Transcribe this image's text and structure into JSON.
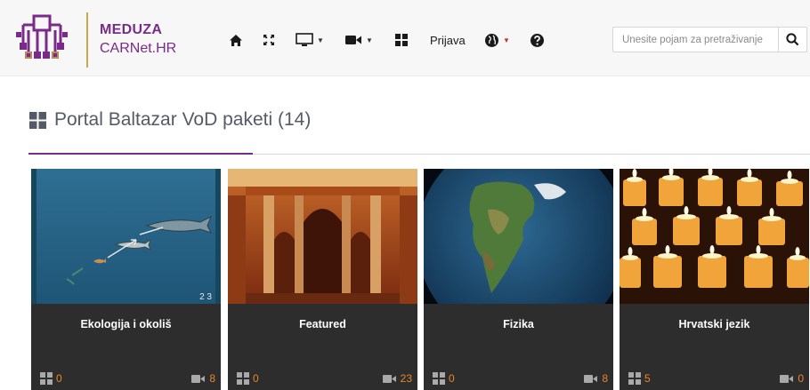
{
  "brand": {
    "title": "MEDUZA",
    "subtitle": "CARNet.HR"
  },
  "nav": {
    "icons": [
      "home-icon",
      "fullscreen-icon",
      "monitor-icon",
      "video-camera-icon",
      "grid-icon",
      "globe-icon",
      "help-icon"
    ],
    "login_label": "Prijava"
  },
  "search": {
    "placeholder": "Unesite pojam za pretraživanje"
  },
  "heading": {
    "title": "Portal Baltazar VoD paketi (14)"
  },
  "cards": [
    {
      "title": "Ekologija i okoliš",
      "packages": "0",
      "videos": "8",
      "frame_number": "2 3"
    },
    {
      "title": "Featured",
      "packages": "0",
      "videos": "23"
    },
    {
      "title": "Fizika",
      "packages": "0",
      "videos": "8"
    },
    {
      "title": "Hrvatski jezik",
      "packages": "5",
      "videos": "0"
    }
  ],
  "colors": {
    "accent": "#7a2b89",
    "count": "#e8862a",
    "card_bg": "#2d2d2d",
    "logo_gold": "#c8a94a"
  }
}
